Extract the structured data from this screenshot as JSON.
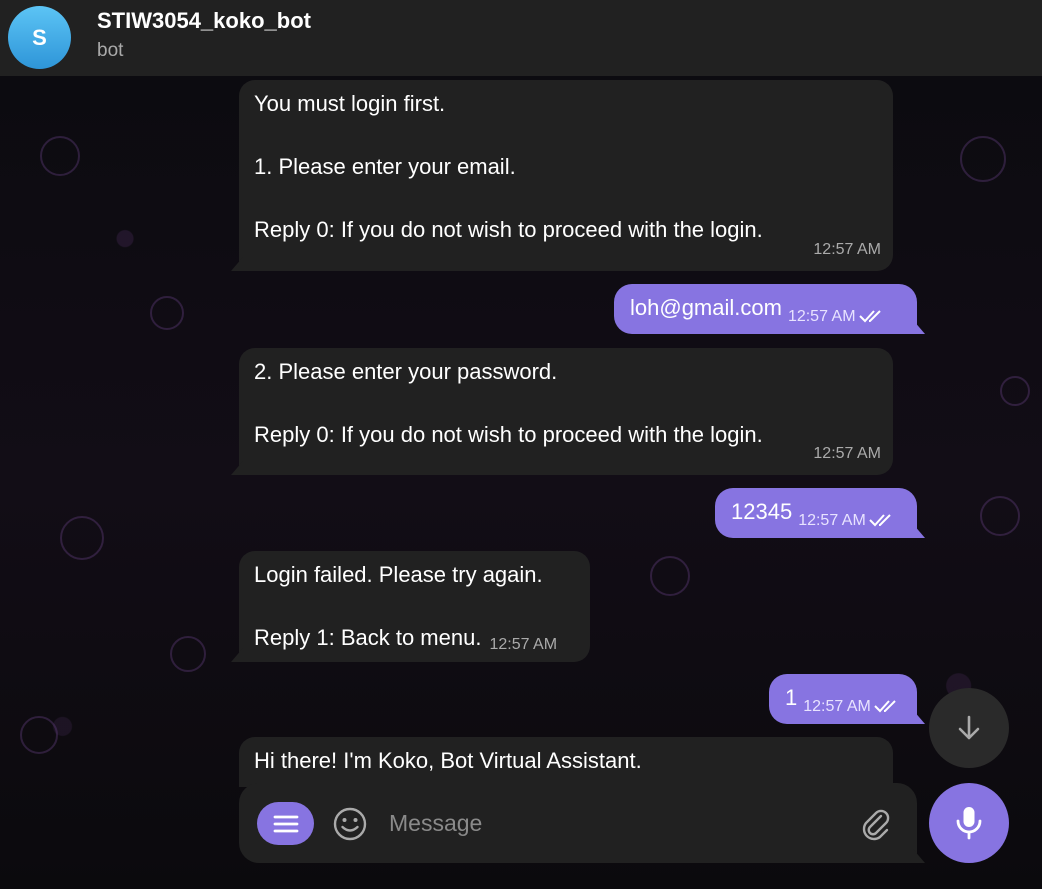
{
  "header": {
    "avatar_letter": "S",
    "title": "STIW3054_koko_bot",
    "subtitle": "bot"
  },
  "messages": [
    {
      "direction": "incoming",
      "lines": [
        "You must login first.",
        "",
        "1. Please enter your email.",
        "",
        "Reply 0: If you do not wish to proceed with the login."
      ],
      "time": "12:57 AM"
    },
    {
      "direction": "outgoing",
      "text": "loh@gmail.com",
      "time": "12:57 AM",
      "read": true
    },
    {
      "direction": "incoming",
      "lines": [
        "2. Please enter your password.",
        "",
        "Reply 0: If you do not wish to proceed with the login."
      ],
      "time": "12:57 AM"
    },
    {
      "direction": "outgoing",
      "text": "12345",
      "time": "12:57 AM",
      "read": true
    },
    {
      "direction": "incoming",
      "lines": [
        "Login failed. Please try again.",
        "",
        "Reply 1: Back to menu."
      ],
      "time": "12:57 AM"
    },
    {
      "direction": "outgoing",
      "text": "1",
      "time": "12:57 AM",
      "read": true
    },
    {
      "direction": "incoming",
      "lines": [
        "Hi there! I'm Koko, Bot Virtual Assistant."
      ],
      "time": ""
    }
  ],
  "composer": {
    "placeholder": "Message",
    "menu_icon": "menu-icon",
    "emoji_icon": "smile-icon",
    "attach_icon": "paperclip-icon",
    "mic_icon": "microphone-icon"
  },
  "scroll_button_icon": "arrow-down-icon",
  "colors": {
    "accent": "#8774e1",
    "bubble_in": "#212121",
    "header_bg": "#212121",
    "avatar": "#3aa6e6"
  }
}
